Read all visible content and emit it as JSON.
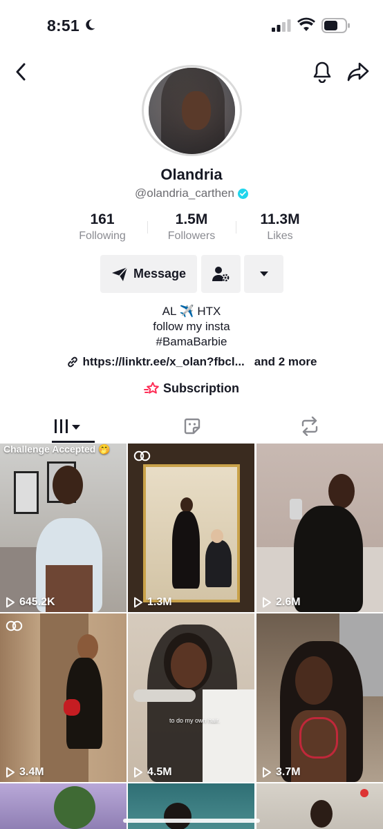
{
  "status_bar": {
    "time": "8:51"
  },
  "profile": {
    "name": "Olandria",
    "handle": "@olandria_carthen",
    "stats": [
      {
        "value": "161",
        "label": "Following"
      },
      {
        "value": "1.5M",
        "label": "Followers"
      },
      {
        "value": "11.3M",
        "label": "Likes"
      }
    ],
    "message_label": "Message",
    "bio": [
      "AL ✈️ HTX",
      "follow my insta",
      "#BamaBarbie"
    ],
    "link": "https://linktr.ee/x_olan?fbcl...",
    "link_more": "and 2 more",
    "subscription_label": "Subscription"
  },
  "videos": [
    {
      "views": "645.2K",
      "caption": "Challenge Accepted 🤭",
      "badge": false
    },
    {
      "views": "1.3M",
      "caption": "",
      "badge": true
    },
    {
      "views": "2.6M",
      "caption": "",
      "badge": false
    },
    {
      "views": "3.4M",
      "caption": "",
      "badge": true
    },
    {
      "views": "4.5M",
      "caption": "to do my own hair.",
      "badge": false
    },
    {
      "views": "3.7M",
      "caption": "",
      "badge": false
    }
  ],
  "colors": {
    "verified": "#20d5ec",
    "subscription_accent": "#fe2c55",
    "text": "#161823",
    "muted": "#8a8b91"
  }
}
